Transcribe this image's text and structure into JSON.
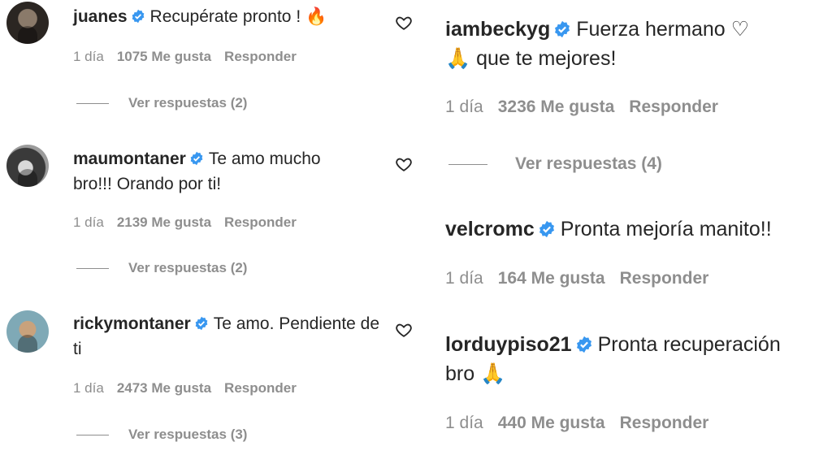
{
  "left_comments": [
    {
      "username": "juanes",
      "text": "Recupérate pronto !",
      "emoji": "🔥",
      "time": "1 día",
      "likes": "1075 Me gusta",
      "reply": "Responder",
      "replies": "Ver respuestas (2)"
    },
    {
      "username": "maumontaner",
      "text": "Te amo mucho bro!!! Orando por ti!",
      "time": "1 día",
      "likes": "2139 Me gusta",
      "reply": "Responder",
      "replies": "Ver respuestas (2)"
    },
    {
      "username": "rickymontaner",
      "text": "Te amo. Pendiente de ti",
      "time": "1 día",
      "likes": "2473 Me gusta",
      "reply": "Responder",
      "replies": "Ver respuestas (3)"
    }
  ],
  "right_comments": [
    {
      "username": "iambeckyg",
      "text": "Fuerza hermano",
      "emoji_heart": "♡",
      "emoji_pray": "🙏",
      "text2": "que te mejores!",
      "time": "1 día",
      "likes": "3236 Me gusta",
      "reply": "Responder",
      "replies": "Ver respuestas (4)"
    },
    {
      "username": "velcromc",
      "text": "Pronta mejoría manito!!",
      "time": "1 día",
      "likes": "164 Me gusta",
      "reply": "Responder"
    },
    {
      "username": "lorduypiso21",
      "text": "Pronta recuperación",
      "text2": "bro",
      "emoji_pray": "🙏",
      "time": "1 día",
      "likes": "440 Me gusta",
      "reply": "Responder"
    }
  ],
  "colors": {
    "verified": "#3897f0",
    "muted": "#8e8e8e",
    "text": "#262626"
  }
}
